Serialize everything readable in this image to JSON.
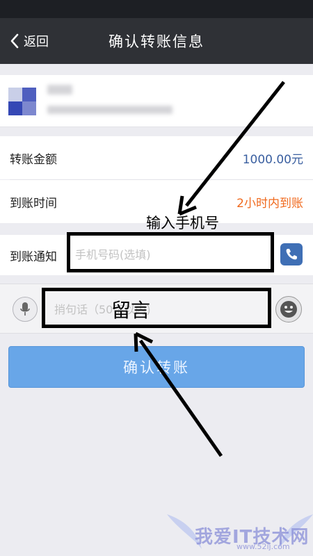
{
  "nav": {
    "back_label": "返回",
    "title": "确认转账信息"
  },
  "rows": {
    "amount_label": "转账金额",
    "amount_value": "1000.00元",
    "arrival_label": "到账时间",
    "arrival_value": "2小时内到账",
    "notify_label": "到账通知",
    "phone_placeholder": "手机号码(选填)"
  },
  "message": {
    "placeholder": "捎句话（50字以内)"
  },
  "confirm_button": "确认转账",
  "annotations": {
    "phone_note": "输入手机号",
    "message_note": "留言"
  },
  "watermark": {
    "text": "我爱IT技术网",
    "url": "www.52ij.com"
  },
  "colors": {
    "nav_bg": "#2f3136",
    "amount_value": "#3a5fa0",
    "arrival_value": "#f06a1e",
    "button_bg": "#68a6e8"
  }
}
